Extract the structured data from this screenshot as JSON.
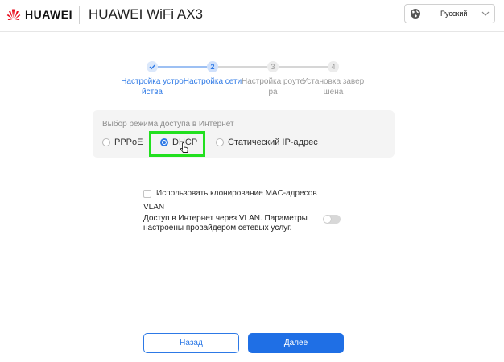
{
  "header": {
    "brand": "HUAWEI",
    "product_title": "HUAWEI WiFi AX3",
    "language": {
      "selected": "Русский",
      "icon": "globe-icon"
    }
  },
  "stepper": {
    "steps": [
      {
        "number": "",
        "label": "Настройка устро йства",
        "state": "done"
      },
      {
        "number": "2",
        "label": "Настройка сети",
        "state": "active"
      },
      {
        "number": "3",
        "label": "Настройка роуте ра",
        "state": "pending"
      },
      {
        "number": "4",
        "label": "Установка завер шена",
        "state": "pending"
      }
    ]
  },
  "access_mode": {
    "label": "Выбор режима доступа в Интернет",
    "options": [
      {
        "label": "PPPoE",
        "selected": false
      },
      {
        "label": "DHCP",
        "selected": true
      },
      {
        "label": "Статический IP-адрес",
        "selected": false
      }
    ]
  },
  "mac_clone": {
    "label": "Использовать клонирование MAC-адресов",
    "checked": false
  },
  "vlan": {
    "title": "VLAN",
    "description": "Доступ в Интернет через VLAN. Параметры настроены провайдером сетевых услуг.",
    "enabled": false
  },
  "buttons": {
    "back": "Назад",
    "next": "Далее"
  },
  "colors": {
    "accent": "#2d79e6",
    "brand_red": "#e60012",
    "highlight": "#22e01f"
  }
}
